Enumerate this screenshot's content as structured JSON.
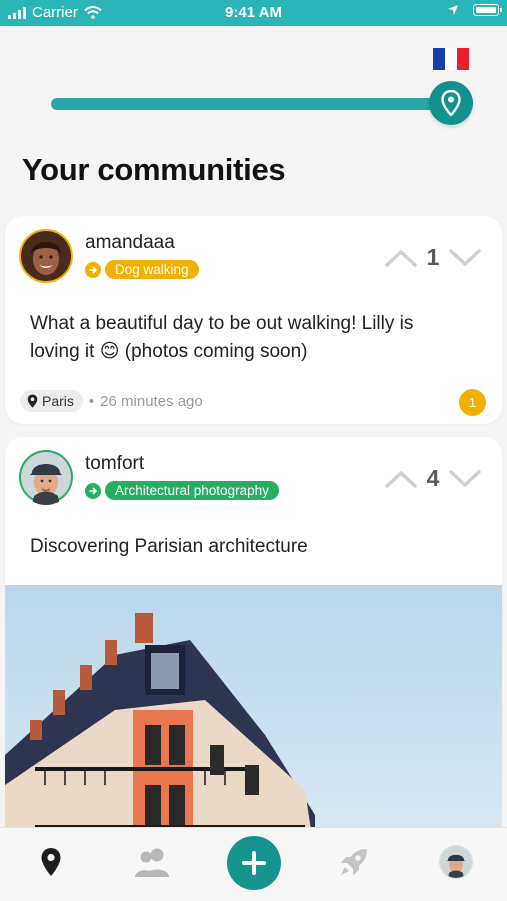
{
  "status_bar": {
    "carrier": "Carrier",
    "time": "9:41 AM"
  },
  "header": {
    "flag": "france-flag",
    "progress": 1.0
  },
  "page": {
    "title": "Your communities"
  },
  "posts": [
    {
      "username": "amandaaa",
      "community": "Dog walking",
      "community_color": "#f2b100",
      "votes": "1",
      "text": "What a beautiful day to be out walking! Lilly is loving it 😊 (photos coming soon)",
      "location": "Paris",
      "time": "26 minutes ago",
      "comments": "1"
    },
    {
      "username": "tomfort",
      "community": "Architectural photography",
      "community_color": "#27ae60",
      "votes": "4",
      "text": "Discovering Parisian architecture"
    }
  ],
  "colors": {
    "accent": "#15948f",
    "status_bar": "#2bb5b8",
    "badge": "#f2b100"
  },
  "nav": [
    "map-pin-icon",
    "people-icon",
    "add-icon",
    "rocket-icon",
    "profile-avatar"
  ]
}
